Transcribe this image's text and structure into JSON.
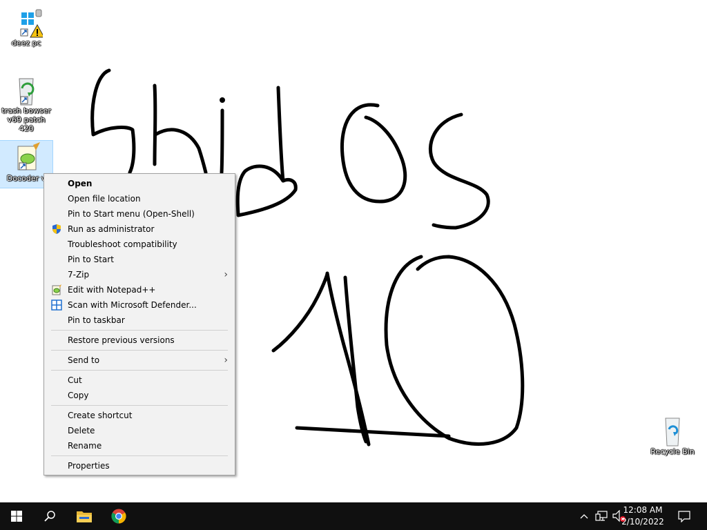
{
  "desktop": {
    "icons": [
      {
        "label": "deez pc"
      },
      {
        "label": "trash bowser\nv69 patch 420"
      },
      {
        "label": "Docoder v"
      },
      {
        "label": "Recycle Bin"
      }
    ]
  },
  "context_menu": {
    "items": [
      {
        "label": "Open"
      },
      {
        "label": "Open file location"
      },
      {
        "label": "Pin to Start menu (Open-Shell)"
      },
      {
        "label": "Run as administrator"
      },
      {
        "label": "Troubleshoot compatibility"
      },
      {
        "label": "Pin to Start"
      },
      {
        "label": "7-Zip"
      },
      {
        "label": "Edit with Notepad++"
      },
      {
        "label": "Scan with Microsoft Defender..."
      },
      {
        "label": "Pin to taskbar"
      },
      {
        "label": "Restore previous versions"
      },
      {
        "label": "Send to"
      },
      {
        "label": "Cut"
      },
      {
        "label": "Copy"
      },
      {
        "label": "Create shortcut"
      },
      {
        "label": "Delete"
      },
      {
        "label": "Rename"
      },
      {
        "label": "Properties"
      }
    ]
  },
  "taskbar": {
    "time": "12:08 AM",
    "date": "2/10/2022",
    "icons": [
      "windows-start-icon",
      "search-icon",
      "file-explorer-icon",
      "chrome-icon"
    ],
    "tray_icons": [
      "chevron-up-icon",
      "network-icon",
      "volume-muted-icon",
      "notification-icon"
    ]
  },
  "colors": {
    "taskbar": "#101010",
    "menu_bg": "#f2f2f2",
    "selection": "#99d1ff"
  }
}
